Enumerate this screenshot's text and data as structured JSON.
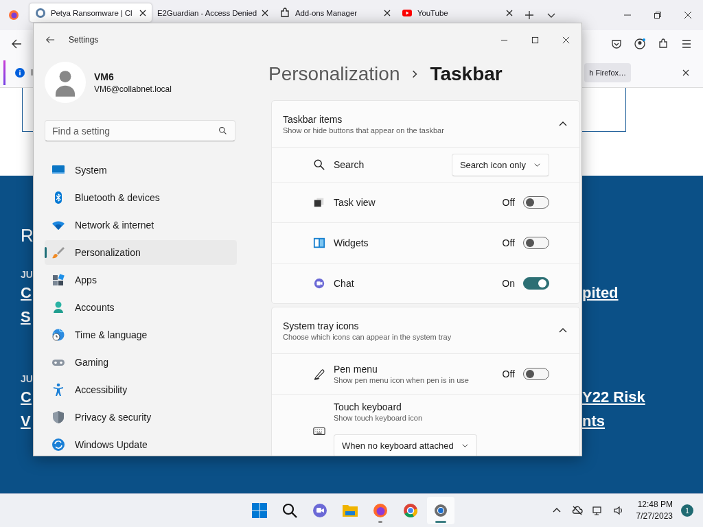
{
  "browser": {
    "tabs": [
      {
        "title": "Petya Ransomware | Cl",
        "selected": true
      },
      {
        "title": "E2Guardian - Access Denied",
        "selected": false
      },
      {
        "title": "Add-ons Manager",
        "selected": false
      },
      {
        "title": "YouTube",
        "selected": false
      }
    ],
    "notification": {
      "text": "I",
      "button": "h Firefox…"
    }
  },
  "page": {
    "lines": [
      {
        "kind": "heading",
        "left": "R"
      },
      {
        "kind": "date",
        "left": "JU"
      },
      {
        "kind": "link",
        "left": "C",
        "right": "pited"
      },
      {
        "kind": "link",
        "left": "S"
      },
      {
        "kind": "date",
        "left": "JU"
      },
      {
        "kind": "link",
        "left": "C",
        "right": "Y22 Risk"
      },
      {
        "kind": "link",
        "left": "V",
        "right": "nts"
      }
    ]
  },
  "settings": {
    "title": "Settings",
    "user": {
      "name": "VM6",
      "email": "VM6@collabnet.local"
    },
    "search": {
      "placeholder": "Find a setting"
    },
    "nav": [
      {
        "label": "System",
        "selected": false
      },
      {
        "label": "Bluetooth & devices",
        "selected": false
      },
      {
        "label": "Network & internet",
        "selected": false
      },
      {
        "label": "Personalization",
        "selected": true
      },
      {
        "label": "Apps",
        "selected": false
      },
      {
        "label": "Accounts",
        "selected": false
      },
      {
        "label": "Time & language",
        "selected": false
      },
      {
        "label": "Gaming",
        "selected": false
      },
      {
        "label": "Accessibility",
        "selected": false
      },
      {
        "label": "Privacy & security",
        "selected": false
      },
      {
        "label": "Windows Update",
        "selected": false
      }
    ],
    "breadcrumb": {
      "parent": "Personalization",
      "current": "Taskbar"
    },
    "sections": [
      {
        "title": "Taskbar items",
        "subtitle": "Show or hide buttons that appear on the taskbar",
        "expanded": true,
        "rows": [
          {
            "kind": "dropdown",
            "label": "Search",
            "value": "Search icon only"
          },
          {
            "kind": "toggle",
            "label": "Task view",
            "state": "Off",
            "on": false
          },
          {
            "kind": "toggle",
            "label": "Widgets",
            "state": "Off",
            "on": false
          },
          {
            "kind": "toggle",
            "label": "Chat",
            "state": "On",
            "on": true
          }
        ]
      },
      {
        "title": "System tray icons",
        "subtitle": "Choose which icons can appear in the system tray",
        "expanded": true,
        "rows": [
          {
            "kind": "toggle",
            "label": "Pen menu",
            "description": "Show pen menu icon when pen is in use",
            "state": "Off",
            "on": false
          },
          {
            "kind": "dropdown-below",
            "label": "Touch keyboard",
            "description": "Show touch keyboard icon",
            "value": "When no keyboard attached"
          }
        ]
      }
    ]
  },
  "taskbar": {
    "apps": [
      {
        "selected": false,
        "running": false
      },
      {
        "selected": false,
        "running": false
      },
      {
        "selected": false,
        "running": false
      },
      {
        "selected": false,
        "running": false
      },
      {
        "selected": false,
        "running": true
      },
      {
        "selected": false,
        "running": false
      },
      {
        "selected": true,
        "running": true
      }
    ],
    "time": "12:48 PM",
    "date": "7/27/2023",
    "badge": "1"
  }
}
